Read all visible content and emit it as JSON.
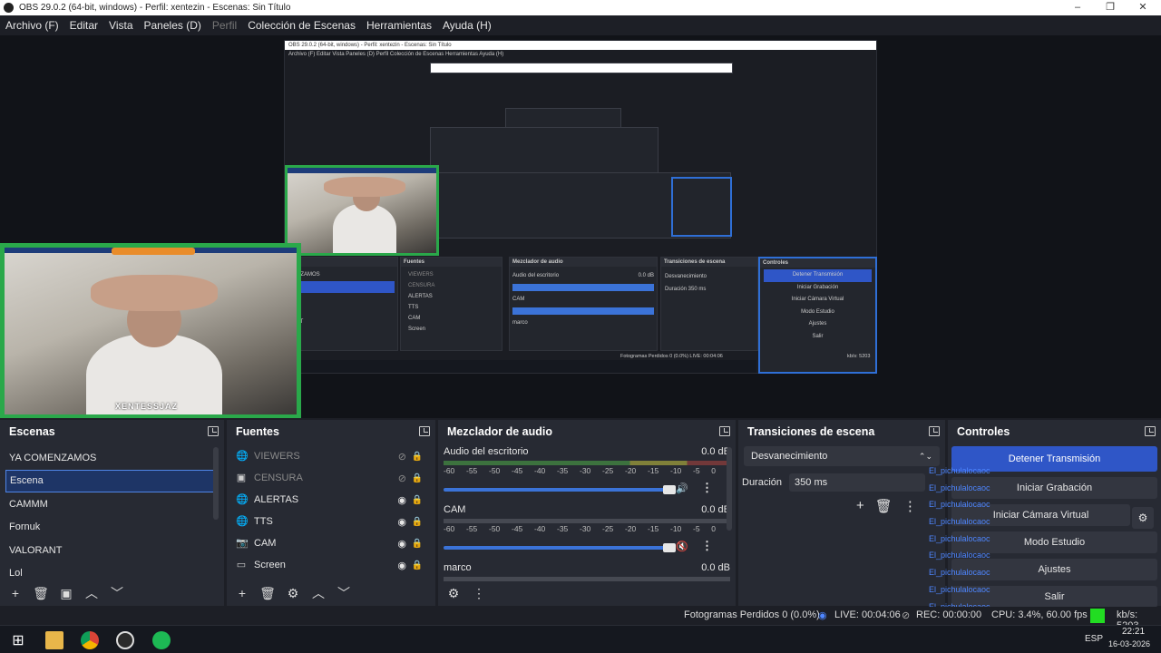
{
  "window": {
    "title": "OBS 29.0.2 (64-bit, windows) - Perfil: xentezin - Escenas: Sin Título",
    "controls": [
      "–",
      "❐",
      "✕"
    ]
  },
  "menu": {
    "items": [
      "Archivo (F)",
      "Editar",
      "Vista",
      "Paneles (D)",
      "Perfil",
      "Colección de Escenas",
      "Herramientas",
      "Ayuda (H)"
    ]
  },
  "preview": {
    "nested_title": "OBS 29.0.2 (64-bit, windows) - Perfil: xentezin - Escenas: Sin Título",
    "nested_menu": "Archivo (F)   Editar   Vista   Paneles (D)   Perfil   Colección de Escenas   Herramientas   Ayuda (H)",
    "cam_tag": "XENTESSJAZ",
    "nested_docks": [
      "Fuentes",
      "Mezclador de audio",
      "Transiciones de escena",
      "Controles"
    ],
    "nested_scene_items": [
      "MENZAMOS",
      "ra",
      "MM",
      "uk",
      "RANT"
    ],
    "nested_sources": [
      "VIEWERS",
      "CENSURA",
      "ALERTAS",
      "TTS",
      "CAM",
      "Screen"
    ],
    "nested_audio": [
      "Audio del escritorio",
      "CAM",
      "marco"
    ],
    "nested_audio_db": "0.0 dB",
    "nested_transition": "Desvanecimiento",
    "nested_duration": "Duración  350 ms",
    "nested_controls": [
      "Detener Transmisión",
      "Iniciar Grabación",
      "Iniciar Cámara Virtual",
      "Modo Estudio",
      "Ajustes",
      "Salir"
    ],
    "nested_status": "Fotogramas Perdidos 0 (0.0%)   LIVE: 00:04:06",
    "nested_kbs": "kb/s: 5203"
  },
  "scenes": {
    "title": "Escenas",
    "items": [
      "YA COMENZAMOS",
      "Escena",
      "CAMMM",
      "Fornuk",
      "VALORANT",
      "Lol"
    ],
    "selected_index": 1,
    "toolbar": [
      "+",
      "🗑",
      "▣",
      "︿",
      "﹀"
    ]
  },
  "sources": {
    "title": "Fuentes",
    "items": [
      {
        "label": "VIEWERS",
        "icon": "🌐",
        "visible": false
      },
      {
        "label": "CENSURA",
        "icon": "▣",
        "visible": false
      },
      {
        "label": "ALERTAS",
        "icon": "🌐",
        "visible": true
      },
      {
        "label": "TTS",
        "icon": "🌐",
        "visible": true
      },
      {
        "label": "CAM",
        "icon": "📷",
        "visible": true
      },
      {
        "label": "Screen",
        "icon": "▭",
        "visible": true
      }
    ],
    "toolbar": [
      "+",
      "🗑",
      "⚙",
      "︿",
      "﹀"
    ]
  },
  "mixer": {
    "title": "Mezclador de audio",
    "scale": [
      "-60",
      "-55",
      "-50",
      "-45",
      "-40",
      "-35",
      "-30",
      "-25",
      "-20",
      "-15",
      "-10",
      "-5",
      "0"
    ],
    "channels": [
      {
        "name": "Audio del escritorio",
        "db": "0.0 dB",
        "volume": 1.0,
        "muted": false
      },
      {
        "name": "CAM",
        "db": "0.0 dB",
        "volume": 1.0,
        "muted": true
      },
      {
        "name": "marco",
        "db": "0.0 dB",
        "volume": 1.0,
        "muted": false
      }
    ]
  },
  "transitions": {
    "title": "Transiciones de escena",
    "selected": "Desvanecimiento",
    "duration_label": "Duración",
    "duration_value": "350 ms"
  },
  "controls": {
    "title": "Controles",
    "buttons": [
      "Detener Transmisión",
      "Iniciar Grabación",
      "Iniciar Cámara Virtual",
      "Modo Estudio",
      "Ajustes",
      "Salir"
    ],
    "overlay_user": "El_pichulalocaoc"
  },
  "status": {
    "dropped": "Fotogramas Perdidos 0 (0.0%)",
    "live": "LIVE: 00:04:06",
    "rec": "REC: 00:00:00",
    "cpu": "CPU: 3.4%, 60.00 fps",
    "kbs": "kb/s: 5203",
    "indicator_color": "#22dd22"
  },
  "taskbar": {
    "lang": "ESP",
    "time": "22:21",
    "date": "16-03-2026"
  },
  "colors": {
    "accent": "#2f56c7",
    "selection": "#1e3566",
    "green_frame": "#2aa84a"
  }
}
